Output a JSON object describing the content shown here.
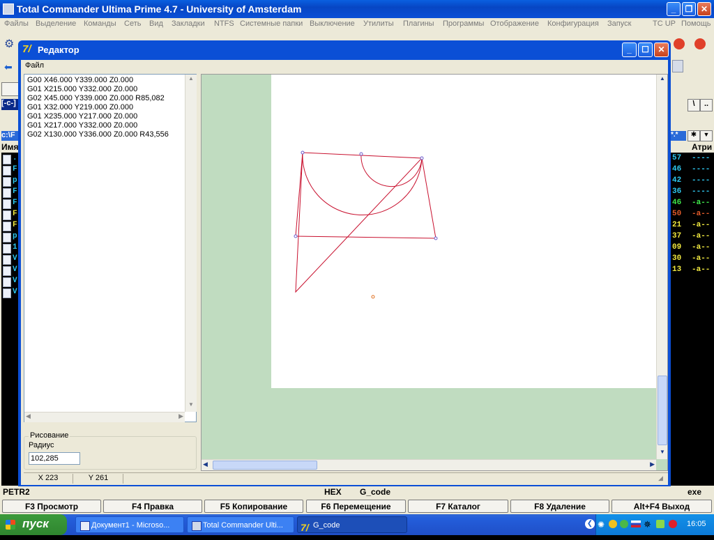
{
  "tc": {
    "title": "Total Commander Ultima Prime 4.7 - University of Amsterdam",
    "menu": [
      "Файлы",
      "Выделение",
      "Команды",
      "Сеть",
      "Вид",
      "Закладки",
      "NTFS",
      "Системные папки",
      "Выключение",
      "Утилиты",
      "Плагины",
      "Программы",
      "Отображение",
      "Конфигурация",
      "Запуск",
      "TC UP",
      "Помощь"
    ],
    "drive_label": "[-c-]",
    "path_label": "c:\\F",
    "col_name": "Имя",
    "col_attr": "Атри",
    "right_rows": [
      {
        "num": "57",
        "attr": "----",
        "color": "#2ec8f0"
      },
      {
        "num": "46",
        "attr": "----",
        "color": "#2ec8f0"
      },
      {
        "num": "42",
        "attr": "----",
        "color": "#2ec8f0"
      },
      {
        "num": "36",
        "attr": "----",
        "color": "#2ec8f0"
      },
      {
        "num": "46",
        "attr": "-a--",
        "color": "#3ee64a"
      },
      {
        "num": "50",
        "attr": "-a--",
        "color": "#e05a2a"
      },
      {
        "num": "21",
        "attr": "-a--",
        "color": "#f0e840"
      },
      {
        "num": "37",
        "attr": "-a--",
        "color": "#f0e840"
      },
      {
        "num": "09",
        "attr": "-a--",
        "color": "#f0e840"
      },
      {
        "num": "30",
        "attr": "-a--",
        "color": "#f0e840"
      },
      {
        "num": "13",
        "attr": "-a--",
        "color": "#f0e840"
      }
    ],
    "left_rows": [
      {
        "txt": "..",
        "color": "#2ec8f0"
      },
      {
        "txt": "F",
        "color": "#2ec8f0"
      },
      {
        "txt": "p",
        "color": "#2ec8f0"
      },
      {
        "txt": "F",
        "color": "#2ec8f0"
      },
      {
        "txt": "F",
        "color": "#2ec8f0"
      },
      {
        "txt": "F",
        "color": "#f0e840"
      },
      {
        "txt": "F",
        "color": "#f0e840"
      },
      {
        "txt": "p",
        "color": "#2ec8f0"
      },
      {
        "txt": "1",
        "color": "#2ec8f0"
      },
      {
        "txt": "V",
        "color": "#2ec8f0"
      },
      {
        "txt": "V",
        "color": "#2ec8f0"
      },
      {
        "txt": "V",
        "color": "#2ec8f0"
      },
      {
        "txt": "V",
        "color": "#2ec8f0"
      }
    ],
    "wildcard": "*.*",
    "status_left": "PETR2",
    "status_hex": "HEX",
    "status_file": "G_code",
    "status_ext": "exe",
    "fkeys": [
      "F3 Просмотр",
      "F4 Правка",
      "F5 Копирование",
      "F6 Перемещение",
      "F7 Каталог",
      "F8 Удаление",
      "Alt+F4 Выход"
    ]
  },
  "editor": {
    "title": "Редактор",
    "menu_file": "Файл",
    "gcode_lines": [
      "G00 X46.000 Y339.000 Z0.000",
      "G01 X215.000 Y332.000 Z0.000",
      "G02 X45.000 Y339.000 Z0.000 R85,082",
      "G01 X32.000 Y219.000 Z0.000",
      "G01 X235.000 Y217.000 Z0.000",
      "G01 X217.000 Y332.000 Z0.000",
      "G02 X130.000 Y336.000 Z0.000 R43,556"
    ],
    "group_title": "Рисование",
    "radius_label": "Радиус",
    "radius_value": "102,285",
    "status_x": "X 223",
    "status_y": "Y 261"
  },
  "taskbar": {
    "start": "пуск",
    "tasks": [
      "Документ1 - Microso...",
      "Total Commander Ulti...",
      "G_code"
    ],
    "clock": "16:05"
  },
  "colors": {
    "xp_blue": "#0b4fd6",
    "canvas_bg": "#c0dcc0",
    "drawing_stroke": "#c8102e"
  }
}
